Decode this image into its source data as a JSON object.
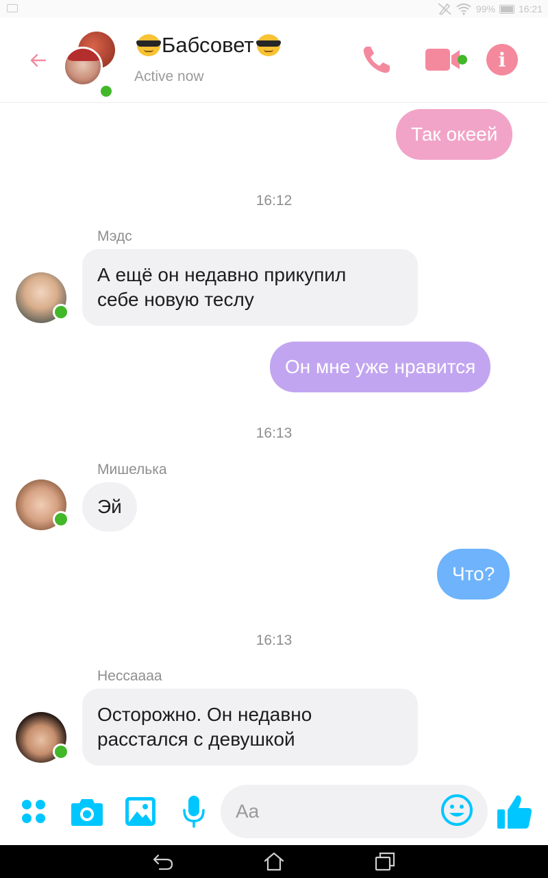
{
  "status_bar": {
    "battery": "99%",
    "time": "16:21",
    "icons": [
      "notification-icon",
      "no-sim-icon",
      "wifi-icon",
      "battery-charging-icon"
    ]
  },
  "header": {
    "title": "Бабсовет",
    "title_emoji": "smiling-face-with-sunglasses",
    "status": "Active now",
    "accent_color": "#f4899d",
    "online_color": "#42b72a"
  },
  "conversation": {
    "messages": [
      {
        "direction": "outgoing",
        "text": "Так океей",
        "color": "#f1a4c7"
      },
      {
        "type": "timestamp",
        "text": "16:12"
      },
      {
        "direction": "incoming",
        "sender": "Мэдс",
        "text_lines": [
          "А ещё он недавно прикупил",
          "себе новую теслу"
        ]
      },
      {
        "direction": "outgoing",
        "text": "Он мне уже нравится",
        "color": "#c2a5f0"
      },
      {
        "type": "timestamp",
        "text": "16:13"
      },
      {
        "direction": "incoming",
        "sender": "Мишелька",
        "text_lines": [
          "Эй"
        ]
      },
      {
        "direction": "outgoing",
        "text": "Что?",
        "color": "#6eb3fb"
      },
      {
        "type": "timestamp",
        "text": "16:13"
      },
      {
        "direction": "incoming",
        "sender": "Нессаааа",
        "text_lines": [
          "Осторожно. Он недавно",
          "расстался с девушкой"
        ]
      }
    ]
  },
  "composer": {
    "placeholder": "Aa",
    "icon_color": "#00c6ff",
    "icons": [
      "apps-icon",
      "camera-icon",
      "gallery-icon",
      "microphone-icon",
      "emoji-icon",
      "thumbs-up-icon"
    ]
  }
}
